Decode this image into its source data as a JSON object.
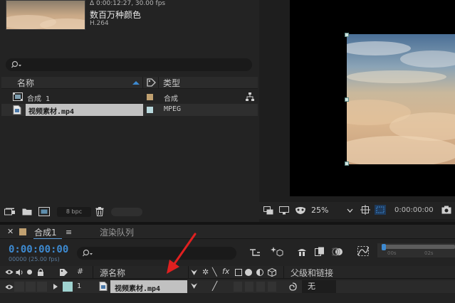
{
  "project": {
    "footage_info": {
      "duration_fps": "Δ 0:00:12:27, 30.00 fps",
      "colors": "数百万种颜色",
      "codec": "H.264"
    },
    "search": {
      "placeholder": ""
    },
    "columns": {
      "name": "名称",
      "type": "类型"
    },
    "items": [
      {
        "name": "合成 1",
        "type": "合成",
        "label_color": "#c0a070",
        "selected": false
      },
      {
        "name": "视频素材.mp4",
        "type": "MPEG",
        "label_color": "#b8d8dc",
        "selected": true
      }
    ],
    "footer": {
      "bit_depth": "8 bpc"
    }
  },
  "viewer": {
    "zoom": "25%",
    "timecode": "0:00:00:00"
  },
  "timeline": {
    "tabs": [
      {
        "label": "合成1",
        "active": true
      },
      {
        "label": "渲染队列",
        "active": false
      }
    ],
    "current_time": "0:00:00:00",
    "frame_info": "00000 (25.00 fps)",
    "search": {
      "placeholder": ""
    },
    "columns": {
      "number": "#",
      "source_name": "源名称",
      "parent": "父级和链接"
    },
    "layers": [
      {
        "index": "1",
        "name": "视频素材.mp4",
        "label_color": "#9fd3d0",
        "parent": "无"
      }
    ],
    "ruler_labels": [
      "00s",
      "02s"
    ]
  }
}
